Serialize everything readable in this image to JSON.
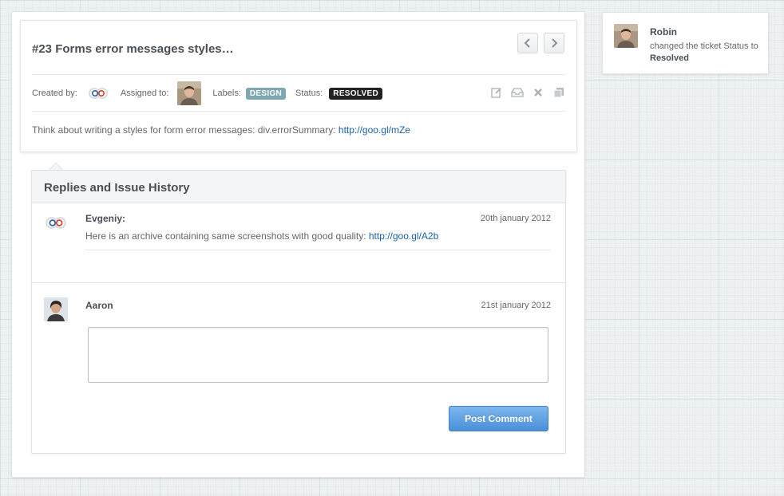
{
  "ticket": {
    "title": "#23 Forms error messages styles…",
    "created_by_label": "Created by:",
    "assigned_to_label": "Assigned to:",
    "labels_label": "Labels:",
    "label_value": "DESIGN",
    "status_label": "Status:",
    "status_value": "RESOLVED",
    "description_text": "Think about writing a styles for form error messages: div.errorSummary: ",
    "description_link": "http://goo.gl/mZe"
  },
  "history": {
    "title": "Replies and Issue History",
    "entries": [
      {
        "author": "Evgeniy:",
        "date": "20th january 2012",
        "text": "Here is an archive containing same screenshots with good quality: ",
        "link": "http://goo.gl/A2b"
      },
      {
        "author": "Aaron",
        "date": "21st january 2012"
      }
    ],
    "reply_value": "",
    "post_button": "Post Comment"
  },
  "notification": {
    "name": "Robin",
    "message_prefix": "changed the ticket Status to ",
    "message_status": "Resolved"
  },
  "colors": {
    "accent_blue": "#4a8fd8",
    "label_design": "#7fa7b2",
    "status_resolved": "#222222",
    "link": "#1a62a8"
  },
  "icons": [
    "chevron-left-icon",
    "chevron-right-icon",
    "edit-icon",
    "archive-icon",
    "close-icon",
    "copy-icon"
  ]
}
